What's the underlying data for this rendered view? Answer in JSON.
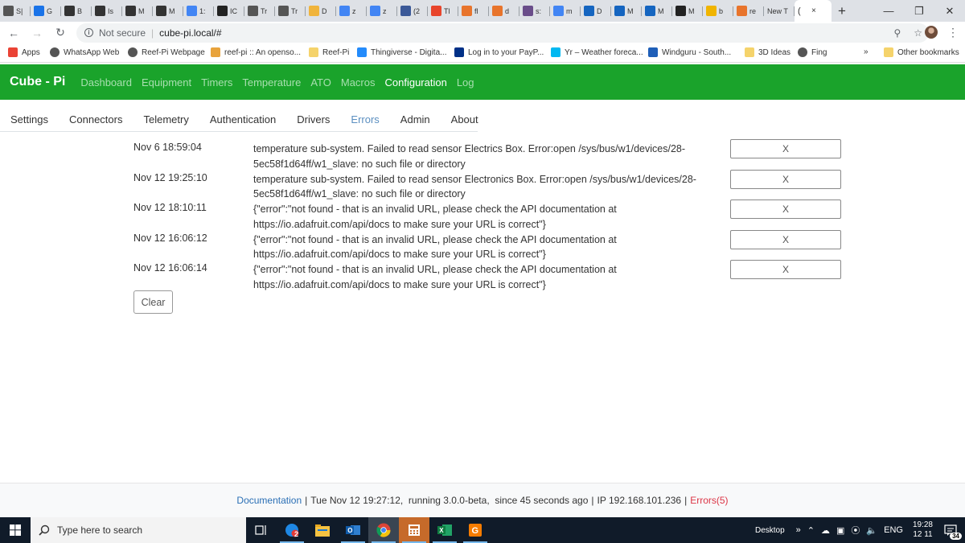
{
  "browser": {
    "tabs": [
      {
        "label": "S|",
        "favicon": "gauge-icon",
        "color": "#555555"
      },
      {
        "label": "G",
        "favicon": "calendar-icon",
        "color": "#1a73e8"
      },
      {
        "label": "B",
        "favicon": "bolt-icon",
        "color": "#333333"
      },
      {
        "label": "Is",
        "favicon": "bolt-icon",
        "color": "#333333"
      },
      {
        "label": "M",
        "favicon": "bolt-icon",
        "color": "#333333"
      },
      {
        "label": "M",
        "favicon": "bolt-icon",
        "color": "#333333"
      },
      {
        "label": "1:",
        "favicon": "google-icon",
        "color": "#4285f4"
      },
      {
        "label": "IC",
        "favicon": "ic-icon",
        "color": "#222222"
      },
      {
        "label": "Tr",
        "favicon": "globe-icon",
        "color": "#555555"
      },
      {
        "label": "Tr",
        "favicon": "globe-icon",
        "color": "#555555"
      },
      {
        "label": "D",
        "favicon": "folder-icon",
        "color": "#f0b43c"
      },
      {
        "label": "z",
        "favicon": "google-icon",
        "color": "#4285f4"
      },
      {
        "label": "z",
        "favicon": "google-icon",
        "color": "#4285f4"
      },
      {
        "label": "(2",
        "favicon": "facebook-icon",
        "color": "#3b5998"
      },
      {
        "label": "Tl",
        "favicon": "c-icon",
        "color": "#e8452c"
      },
      {
        "label": "fl",
        "favicon": "bg-icon",
        "color": "#e8742c"
      },
      {
        "label": "d",
        "favicon": "bg-icon",
        "color": "#e8742c"
      },
      {
        "label": "s:",
        "favicon": "square-icon",
        "color": "#6a4d8a"
      },
      {
        "label": "m",
        "favicon": "google-icon",
        "color": "#4285f4"
      },
      {
        "label": "D",
        "favicon": "m-icon",
        "color": "#1565c0"
      },
      {
        "label": "M",
        "favicon": "m-icon",
        "color": "#1565c0"
      },
      {
        "label": "M",
        "favicon": "m-icon",
        "color": "#1565c0"
      },
      {
        "label": "M",
        "favicon": "amazon-icon",
        "color": "#222222"
      },
      {
        "label": "b",
        "favicon": "b-icon",
        "color": "#f0b400"
      },
      {
        "label": "re",
        "favicon": "folder-icon",
        "color": "#e8742c"
      },
      {
        "label": "New T",
        "favicon": "",
        "color": "#dee1e6"
      }
    ],
    "active_tab": {
      "label": "(",
      "close": "×"
    },
    "new_tab": "+",
    "address": {
      "security": "Not secure",
      "separator": "|",
      "url": "cube-pi.local/#"
    },
    "bookmarks": [
      {
        "label": "Apps",
        "icon": "apps-grid-icon",
        "color": "#ea4335"
      },
      {
        "label": "WhatsApp Web",
        "icon": "globe-icon",
        "color": "#555555"
      },
      {
        "label": "Reef-Pi Webpage",
        "icon": "globe-icon",
        "color": "#555555"
      },
      {
        "label": "reef-pi :: An openso...",
        "icon": "stack-icon",
        "color": "#e8a33c"
      },
      {
        "label": "Reef-Pi",
        "icon": "folder-icon",
        "color": "#f5d36b"
      },
      {
        "label": "Thingiverse - Digita...",
        "icon": "thingiverse-icon",
        "color": "#248bfb"
      },
      {
        "label": "Log in to your PayP...",
        "icon": "paypal-icon",
        "color": "#003087"
      },
      {
        "label": "Yr – Weather foreca...",
        "icon": "yr-icon",
        "color": "#00b8f1"
      },
      {
        "label": "Windguru - South...",
        "icon": "windguru-icon",
        "color": "#1f5fb8"
      },
      {
        "label": "3D Ideas",
        "icon": "folder-icon",
        "color": "#f5d36b"
      },
      {
        "label": "Fing",
        "icon": "globe-icon",
        "color": "#555555"
      }
    ],
    "bookmarks_more": "»",
    "other_bookmarks": "Other bookmarks"
  },
  "app": {
    "brand": "Cube - Pi",
    "nav": [
      "Dashboard",
      "Equipment",
      "Timers",
      "Temperature",
      "ATO",
      "Macros",
      "Configuration",
      "Log"
    ],
    "nav_active": "Configuration",
    "subtabs": [
      "Settings",
      "Connectors",
      "Telemetry",
      "Authentication",
      "Drivers",
      "Errors",
      "Admin",
      "About"
    ],
    "subtab_active": "Errors",
    "errors": [
      {
        "time": "Nov 6 18:59:04",
        "message": "temperature sub-system. Failed to read sensor Electrics Box. Error:open /sys/bus/w1/devices/28-5ec58f1d64ff/w1_slave: no such file or directory",
        "delete": "X"
      },
      {
        "time": "Nov 12 19:25:10",
        "message": "temperature sub-system. Failed to read sensor Electronics Box. Error:open /sys/bus/w1/devices/28-5ec58f1d64ff/w1_slave: no such file or directory",
        "delete": "X"
      },
      {
        "time": "Nov 12 18:10:11",
        "message": "{\"error\":\"not found - that is an invalid URL, please check the API documentation at https://io.adafruit.com/api/docs to make sure your URL is correct\"}",
        "delete": "X"
      },
      {
        "time": "Nov 12 16:06:12",
        "message": "{\"error\":\"not found - that is an invalid URL, please check the API documentation at https://io.adafruit.com/api/docs to make sure your URL is correct\"}",
        "delete": "X"
      },
      {
        "time": "Nov 12 16:06:14",
        "message": "{\"error\":\"not found - that is an invalid URL, please check the API documentation at https://io.adafruit.com/api/docs to make sure your URL is correct\"}",
        "delete": "X"
      }
    ],
    "clear_label": "Clear",
    "footer": {
      "documentation": "Documentation",
      "time": "Tue Nov 12 19:27:12,",
      "running": "running 3.0.0-beta,",
      "since": "since 45 seconds ago",
      "ip": "IP 192.168.101.236",
      "errors_link": "Errors(5)"
    },
    "colors": {
      "navbar": "#1aa32b",
      "link": "#2a6fb5",
      "error": "#dc3545",
      "active_subtab": "#5b8fc0"
    }
  },
  "taskbar": {
    "search_placeholder": "Type here to search",
    "outlook_badge": "2",
    "desktop_label": "Desktop",
    "overflow": "»",
    "language": "ENG",
    "time": "19:28",
    "date": "12 11",
    "notifications": "34"
  }
}
